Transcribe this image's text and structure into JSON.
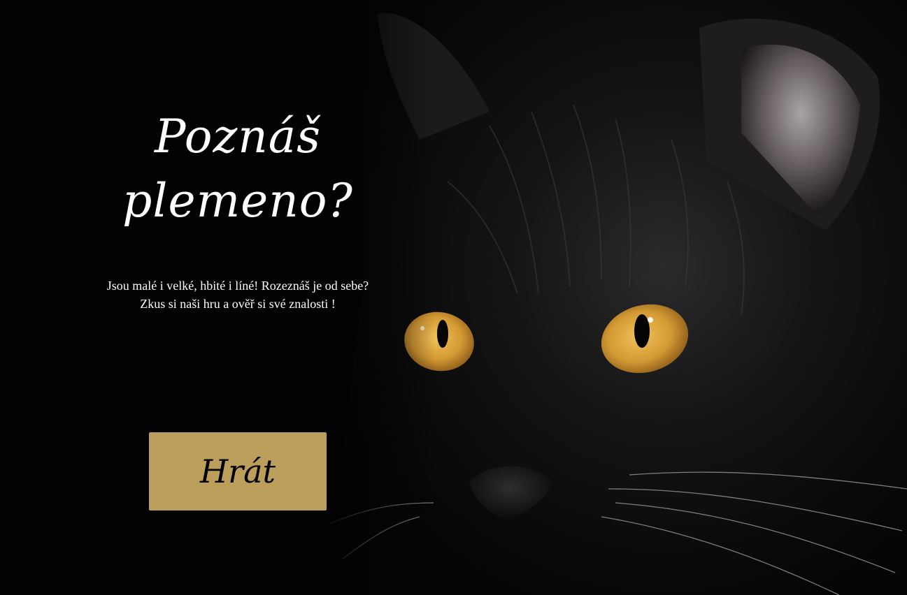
{
  "hero": {
    "title_line1": "Poznáš",
    "title_line2": "plemeno?",
    "description": "Jsou malé i velké, hbité i líné! Rozeznáš je od sebe? Zkus si naši hru a ověř si své znalosti !",
    "play_label": "Hrát"
  },
  "colors": {
    "background": "#000000",
    "button": "#bb9e5b",
    "text": "#ffffff",
    "eye": "#d8a23a"
  },
  "icons": {
    "hero_image": "black-cat-photo"
  }
}
